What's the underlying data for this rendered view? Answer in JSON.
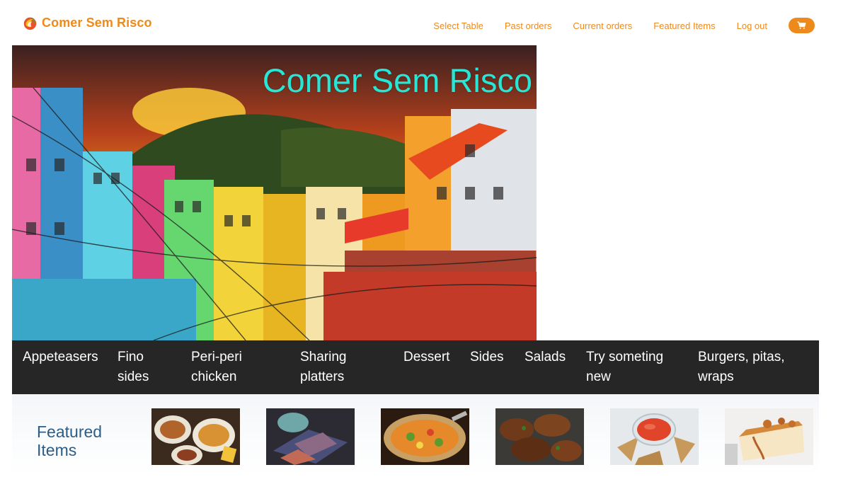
{
  "brand": {
    "name": "Comer Sem Risco",
    "logo_icon": "flame-logo-icon"
  },
  "nav": {
    "links": [
      {
        "label": "Select Table"
      },
      {
        "label": "Past orders"
      },
      {
        "label": "Current orders"
      },
      {
        "label": "Featured Items"
      },
      {
        "label": "Log out"
      }
    ],
    "cart_icon": "shopping-cart-icon"
  },
  "hero": {
    "title": "Comer Sem Risco"
  },
  "categories": [
    {
      "label": "Appeteasers"
    },
    {
      "label": "Fino sides"
    },
    {
      "label": "Peri-peri chicken"
    },
    {
      "label": "Sharing platters"
    },
    {
      "label": "Dessert"
    },
    {
      "label": "Sides"
    },
    {
      "label": "Salads"
    },
    {
      "label": "Try someting new"
    },
    {
      "label": "Burgers, pitas, wraps"
    }
  ],
  "featured": {
    "title": "Featured Items",
    "items": [
      {
        "image": "sharing-platter-photo"
      },
      {
        "image": "dessert-plate-photo"
      },
      {
        "image": "pan-dish-photo"
      },
      {
        "image": "grilled-chicken-photo"
      },
      {
        "image": "salsa-nachos-photo"
      },
      {
        "image": "cheesecake-photo"
      }
    ]
  },
  "colors": {
    "accent": "#ee8a1c",
    "hero_title": "#27e6d6",
    "category_bar": "#262626",
    "featured_title": "#2b5d86"
  }
}
